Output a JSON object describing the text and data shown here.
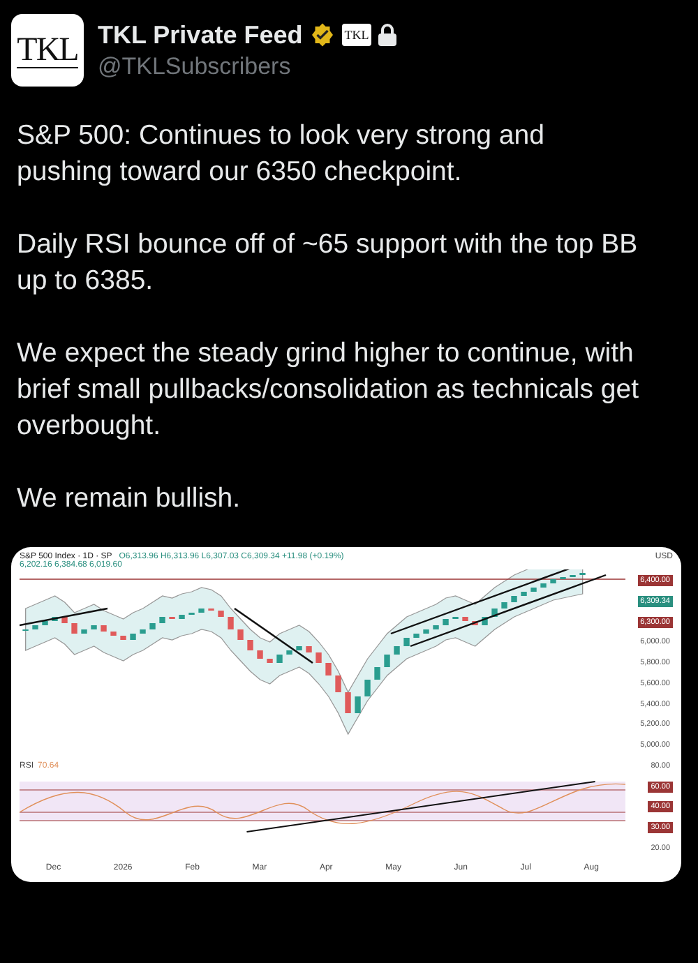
{
  "author": {
    "name": "TKL Private Feed",
    "handle": "@TKLSubscribers",
    "verified": true,
    "protected": true,
    "avatar_text": "TKL",
    "badge_text": "TKL"
  },
  "paragraphs": [
    "S&P 500: Continues to look very strong and pushing toward our 6350 checkpoint.",
    "Daily RSI bounce off of ~65 support with the top BB up to 6385.",
    "We expect the steady grind higher to continue, with brief small pullbacks/consolidation as technicals get overbought.",
    "We remain bullish."
  ],
  "chart_image": {
    "symbol": "S&P 500 Index · 1D · SP",
    "ohlc": "O6,313.96 H6,313.96 L6,307.03 C6,309.34 +11.98 (+0.19%)",
    "bands": "6,202.16 6,384.68 6,019.60",
    "currency": "USD",
    "price_labels": [
      {
        "text": "6,400.00",
        "kind": "line"
      },
      {
        "text": "6,309.34",
        "kind": "price"
      },
      {
        "text": "6,300.00",
        "kind": "line"
      },
      {
        "text": "6,000.00",
        "kind": "plain"
      },
      {
        "text": "5,800.00",
        "kind": "plain"
      },
      {
        "text": "5,600.00",
        "kind": "plain"
      },
      {
        "text": "5,400.00",
        "kind": "plain"
      },
      {
        "text": "5,200.00",
        "kind": "plain"
      },
      {
        "text": "5,000.00",
        "kind": "plain"
      }
    ],
    "rsi_label": "RSI",
    "rsi_value": "70.64",
    "rsi_labels": [
      {
        "text": "80.00",
        "kind": "plain"
      },
      {
        "text": "60.00",
        "kind": "line"
      },
      {
        "text": "40.00",
        "kind": "line"
      },
      {
        "text": "30.00",
        "kind": "line"
      },
      {
        "text": "20.00",
        "kind": "plain"
      }
    ],
    "months": [
      "Dec",
      "2026",
      "Feb",
      "Mar",
      "Apr",
      "May",
      "Jun",
      "Jul",
      "Aug"
    ]
  }
}
